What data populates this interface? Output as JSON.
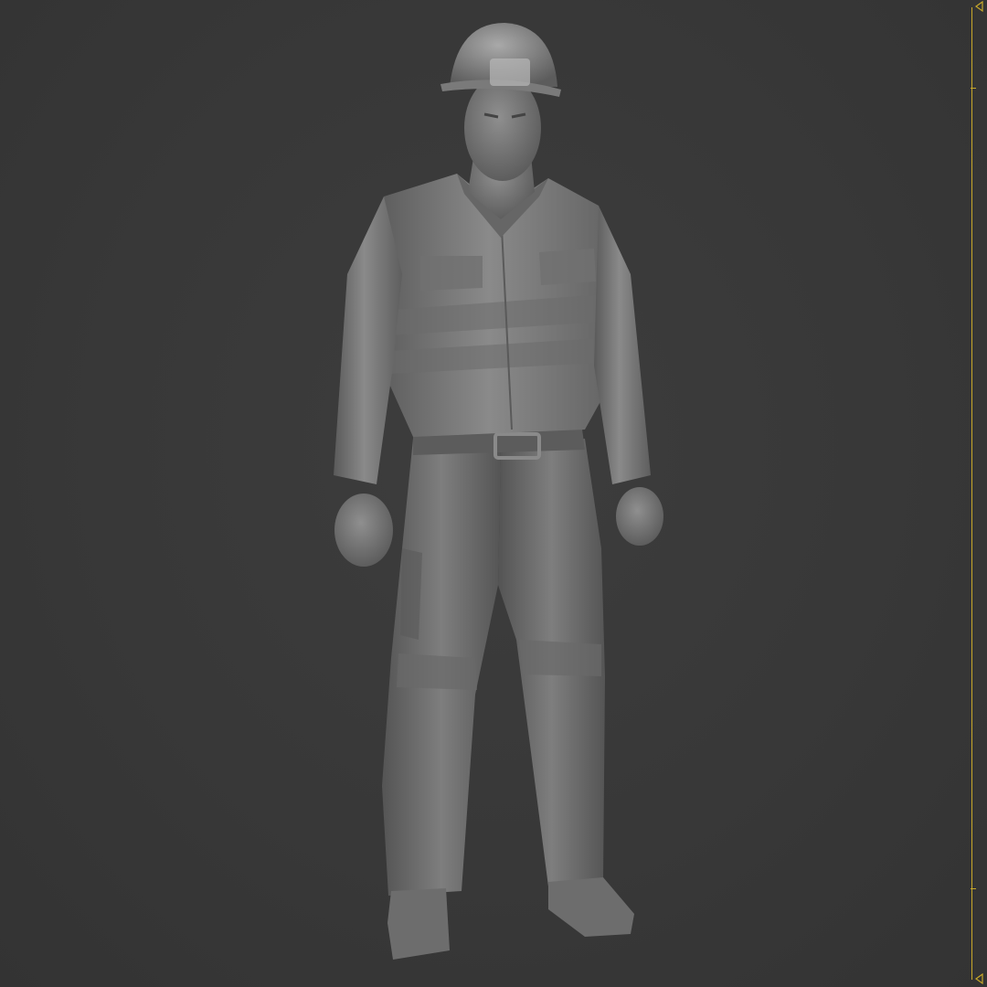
{
  "viewport": {
    "background": "#3a3a3a",
    "model": "sculpt-worker-figure",
    "model_shade": "#7a7a7a",
    "frame_accent": "#c8a82a"
  }
}
